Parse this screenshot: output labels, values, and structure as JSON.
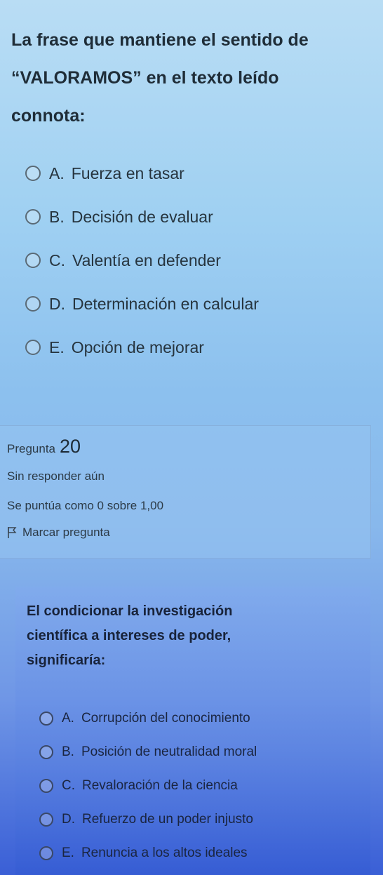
{
  "question1": {
    "text_lines": [
      "La frase que mantiene el sentido de",
      "“VALORAMOS” en el texto leído",
      "connota:"
    ],
    "options": [
      {
        "letter": "A.",
        "text": "Fuerza en tasar"
      },
      {
        "letter": "B.",
        "text": "Decisión de evaluar"
      },
      {
        "letter": "C.",
        "text": "Valentía en defender"
      },
      {
        "letter": "D.",
        "text": "Determinación en calcular"
      },
      {
        "letter": "E.",
        "text": "Opción de mejorar"
      }
    ]
  },
  "question_info": {
    "label": "Pregunta",
    "number": "20",
    "status": "Sin responder aún",
    "score": "Se puntúa como 0 sobre 1,00",
    "flag_label": "Marcar pregunta",
    "flag_icon": "flag-icon"
  },
  "question2": {
    "text_lines": [
      "El condicionar la investigación",
      "científica a intereses de poder,",
      "significaría:"
    ],
    "options": [
      {
        "letter": "A.",
        "text": "Corrupción del conocimiento"
      },
      {
        "letter": "B.",
        "text": "Posición de neutralidad moral"
      },
      {
        "letter": "C.",
        "text": "Revaloración de la ciencia"
      },
      {
        "letter": "D.",
        "text": "Refuerzo de un poder injusto"
      },
      {
        "letter": "E.",
        "text": "Renuncia a los altos ideales"
      }
    ]
  }
}
